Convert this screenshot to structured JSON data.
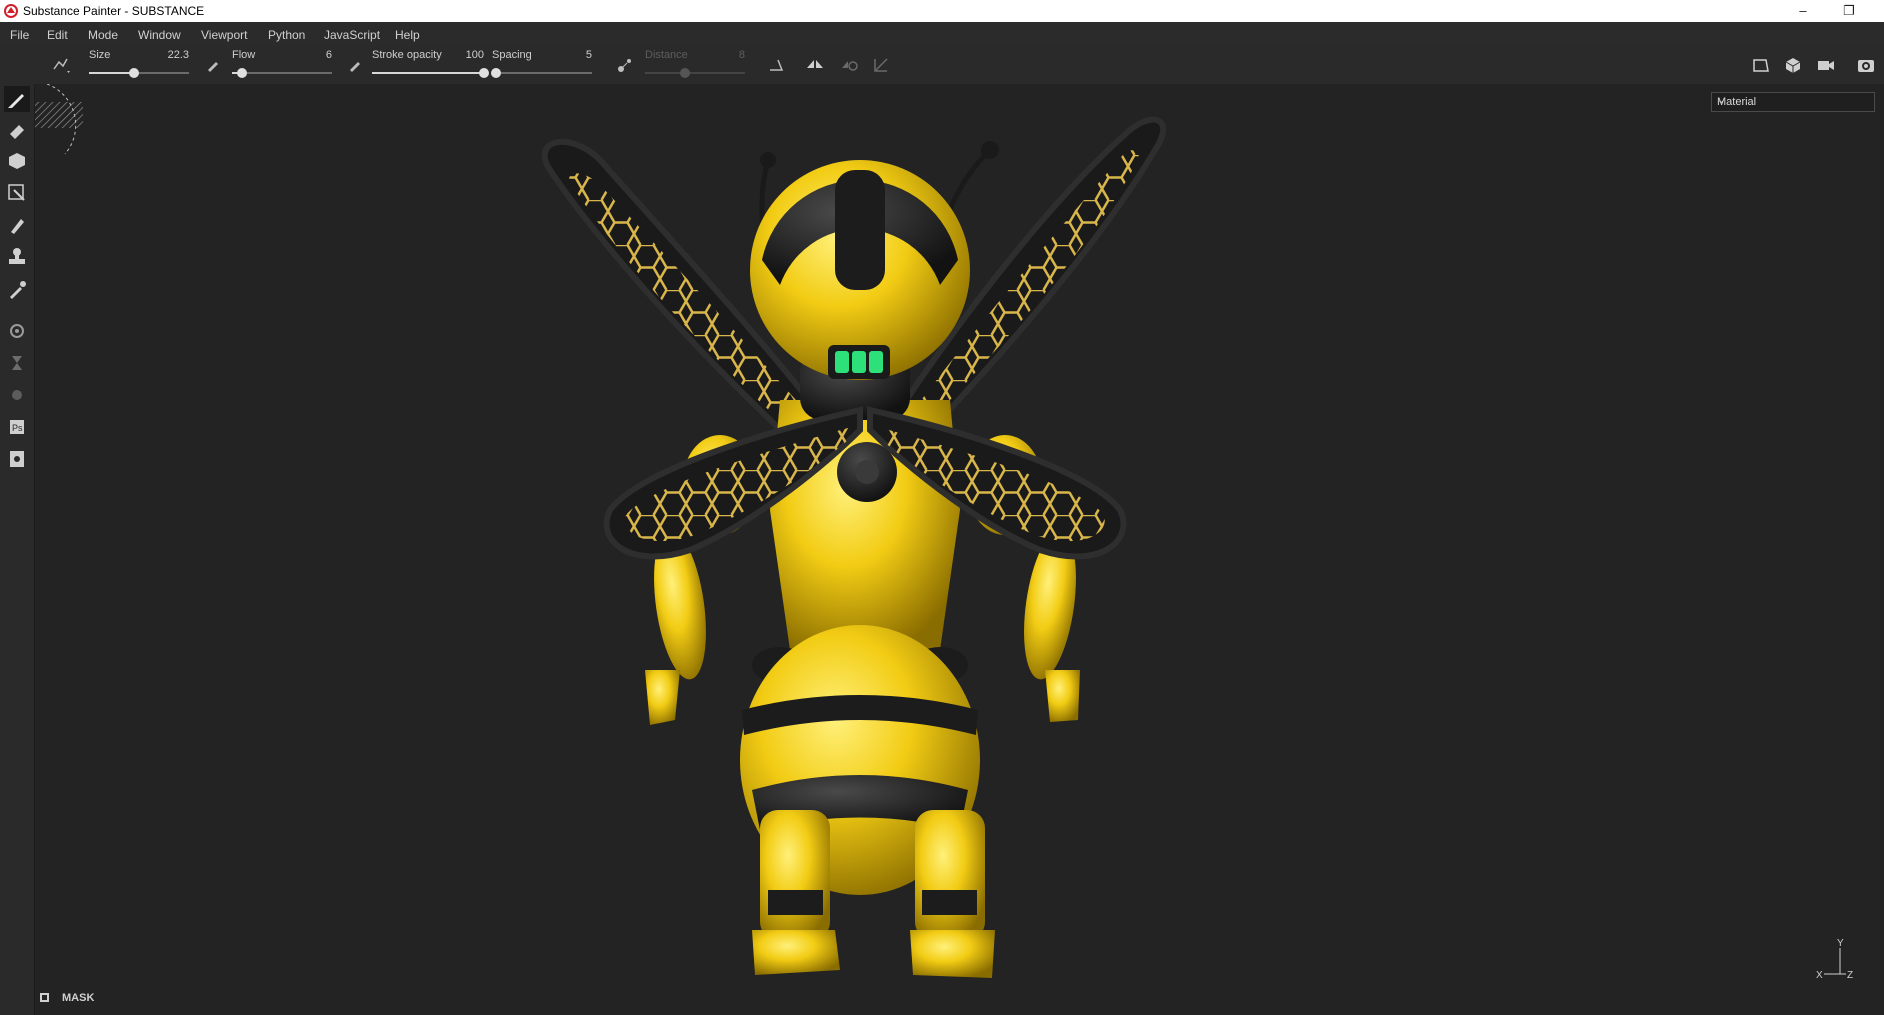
{
  "window": {
    "title": "Substance Painter - SUBSTANCE",
    "minimize_glyph": "–",
    "restore_glyph": "❐"
  },
  "menu": [
    "File",
    "Edit",
    "Mode",
    "Window",
    "Viewport",
    "Python",
    "JavaScript",
    "Help"
  ],
  "tool_options": {
    "size": {
      "label": "Size",
      "value": "22.3",
      "level_percent": 45
    },
    "flow": {
      "label": "Flow",
      "value": "6",
      "level_percent": 10
    },
    "stroke_opacity": {
      "label": "Stroke opacity",
      "value": "100",
      "level_percent": 100
    },
    "spacing": {
      "label": "Spacing",
      "value": "5",
      "level_percent": 4
    },
    "distance": {
      "label": "Distance",
      "value": "8",
      "level_percent": 40,
      "disabled": true
    }
  },
  "viewport": {
    "channel_select": "Material",
    "mask_label": "MASK",
    "axis": {
      "y": "Y",
      "x": "X",
      "z": "Z"
    }
  },
  "left_tools": [
    "paint-brush-icon",
    "eraser-icon",
    "projection-icon",
    "polygon-fill-icon",
    "smudge-icon",
    "clone-stamp-icon",
    "color-picker-icon",
    "bake-icon",
    "iray-icon",
    "geometry-icon",
    "photoshop-export-icon",
    "screenshot-icon"
  ],
  "colors": {
    "app_bg": "#232323",
    "panel_bg": "#2a2a2a",
    "bee_yellow": "#f2cc14",
    "bee_black": "#1c1c1c",
    "wing_pattern": "#d9b64a",
    "led_green": "#2de07a"
  }
}
